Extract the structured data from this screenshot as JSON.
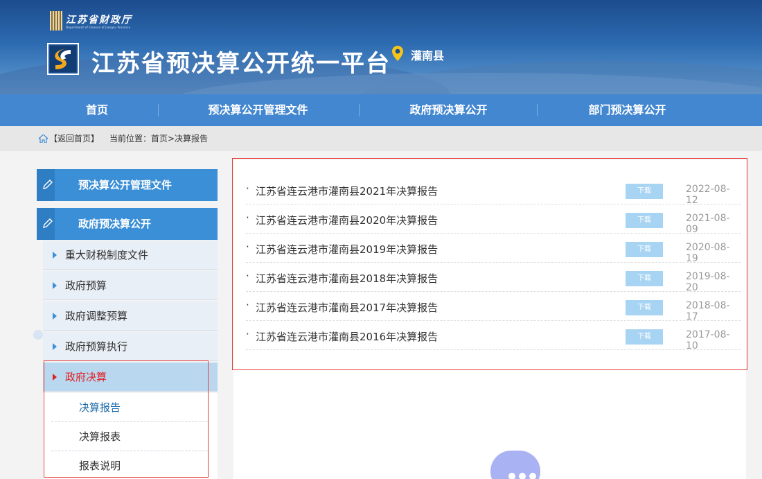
{
  "header": {
    "dept_name": "江苏省财政厅",
    "dept_name_en": "Department of Finance of Jiangsu Province",
    "site_title": "江苏省预决算公开统一平台",
    "county": "灌南县"
  },
  "nav": {
    "items": [
      {
        "label": "首页"
      },
      {
        "label": "预决算公开管理文件"
      },
      {
        "label": "政府预决算公开"
      },
      {
        "label": "部门预决算公开"
      }
    ]
  },
  "breadcrumb": {
    "back": "【返回首页】",
    "location": "当前位置：首页>决算报告"
  },
  "sidebar": {
    "sections": [
      {
        "label": "预决算公开管理文件"
      },
      {
        "label": "政府预决算公开"
      }
    ],
    "sub_items": [
      {
        "label": "重大财税制度文件"
      },
      {
        "label": "政府预算"
      },
      {
        "label": "政府调整预算"
      },
      {
        "label": "政府预算执行"
      },
      {
        "label": "政府决算"
      }
    ],
    "leaf_items": [
      {
        "label": "决算报告"
      },
      {
        "label": "决算报表"
      },
      {
        "label": "报表说明"
      }
    ]
  },
  "list": {
    "bullet": "·",
    "download_label": "下载",
    "rows": [
      {
        "title": "江苏省连云港市灌南县2021年决算报告",
        "date": "2022-08-12"
      },
      {
        "title": "江苏省连云港市灌南县2020年决算报告",
        "date": "2021-08-09"
      },
      {
        "title": "江苏省连云港市灌南县2019年决算报告",
        "date": "2020-08-19"
      },
      {
        "title": "江苏省连云港市灌南县2018年决算报告",
        "date": "2019-08-20"
      },
      {
        "title": "江苏省连云港市灌南县2017年决算报告",
        "date": "2018-08-17"
      },
      {
        "title": "江苏省连云港市灌南县2016年决算报告",
        "date": "2017-08-10"
      }
    ]
  },
  "colors": {
    "nav_blue": "#4387d0",
    "sidebar_blue": "#3b8fd6",
    "active_red": "#e02020",
    "download_bg": "#a8d4f3",
    "highlight_box": "#e53935"
  }
}
